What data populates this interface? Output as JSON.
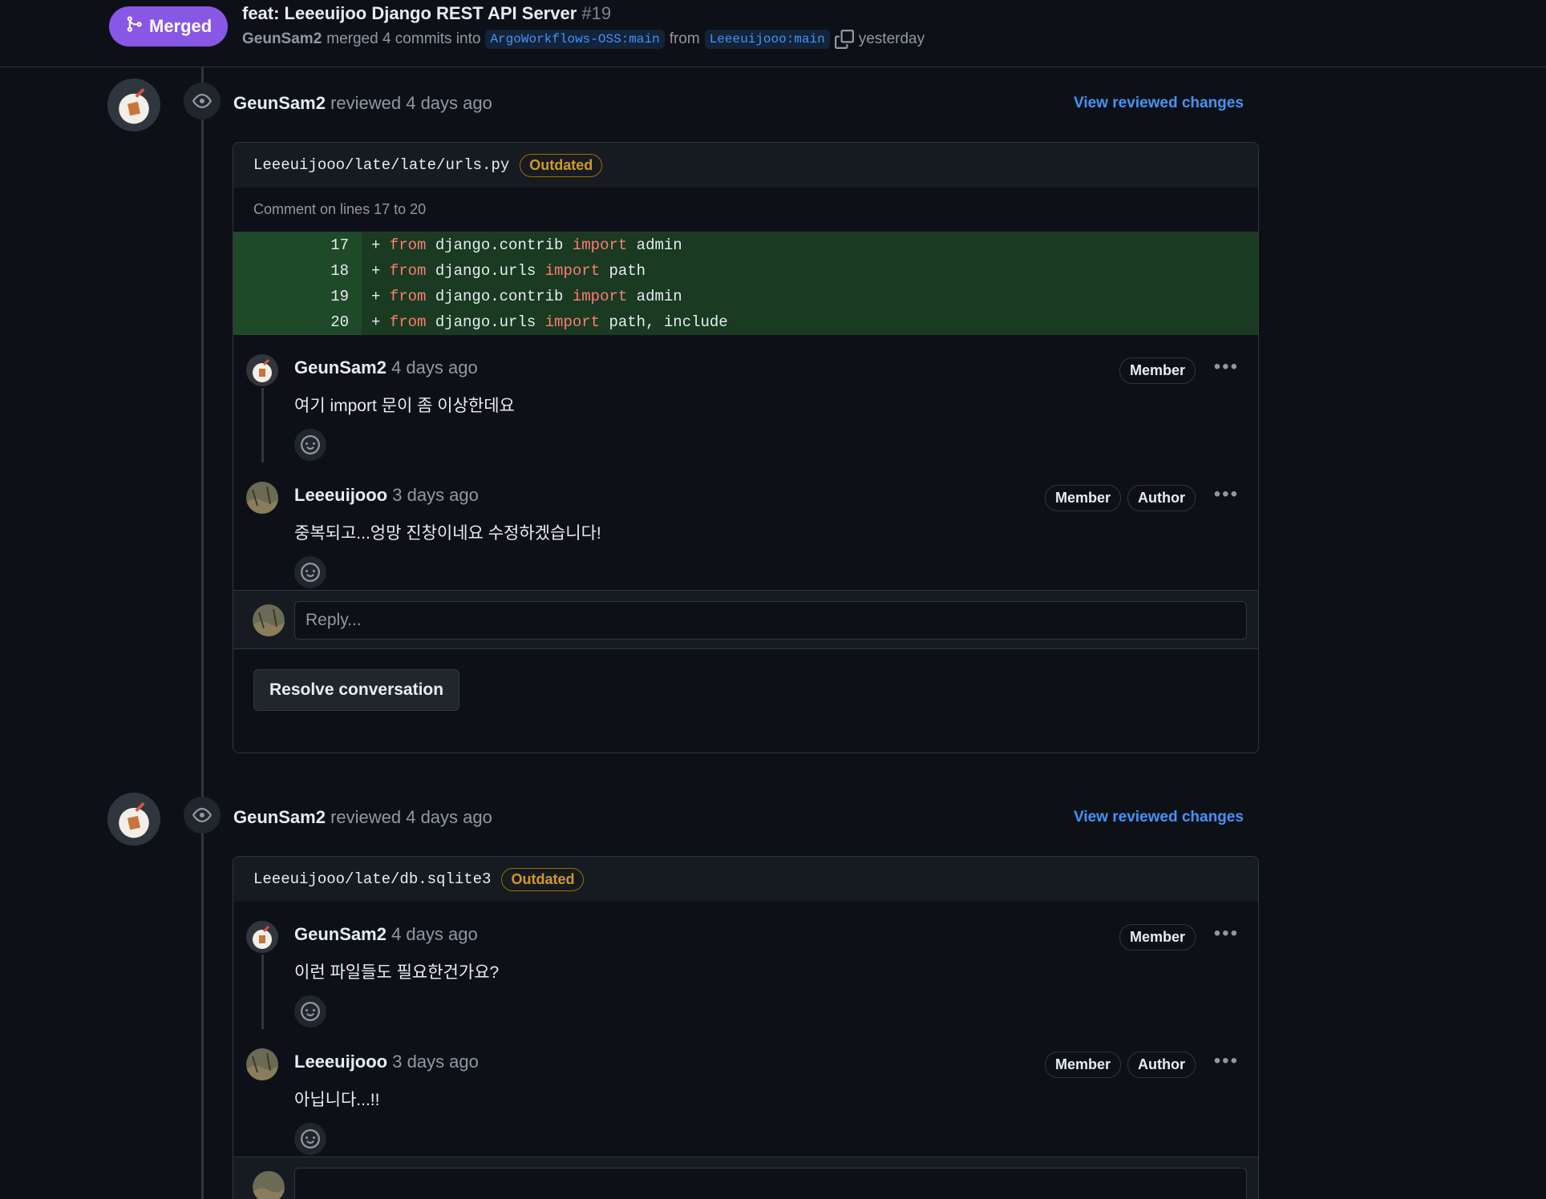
{
  "header": {
    "status": "Merged",
    "title": "feat: Leeeuijoo Django REST API Server",
    "number": "#19",
    "merged_by": "GeunSam2",
    "merged_text": "merged 4 commits into",
    "base_branch": "ArgoWorkflows-OSS:main",
    "from_text": "from",
    "head_branch": "Leeeuijooo:main",
    "time": "yesterday"
  },
  "reviews": [
    {
      "reviewer": "GeunSam2",
      "action": "reviewed 4 days ago",
      "view_link": "View reviewed changes",
      "file_path": "Leeeuijooo/late/late/urls.py",
      "outdated": "Outdated",
      "comment_lines": "Comment on lines 17 to 20",
      "code": [
        {
          "ln": "17",
          "pre": "+ ",
          "kw1": "from",
          "mid": " django.contrib ",
          "kw2": "import",
          "post": " admin"
        },
        {
          "ln": "18",
          "pre": "+ ",
          "kw1": "from",
          "mid": " django.urls ",
          "kw2": "import",
          "post": " path"
        },
        {
          "ln": "19",
          "pre": "+ ",
          "kw1": "from",
          "mid": " django.contrib ",
          "kw2": "import",
          "post": " admin"
        },
        {
          "ln": "20",
          "pre": "+ ",
          "kw1": "from",
          "mid": " django.urls ",
          "kw2": "import",
          "post": " path, include"
        }
      ],
      "comments": [
        {
          "author": "GeunSam2",
          "time": "4 days ago",
          "body": "여기 import 문이 좀 이상한데요",
          "badges": [
            "Member"
          ]
        },
        {
          "author": "Leeeuijooo",
          "time": "3 days ago",
          "body": "중복되고...엉망 진창이네요 수정하겠습니다!",
          "badges": [
            "Member",
            "Author"
          ]
        }
      ],
      "reply_placeholder": "Reply...",
      "resolve_label": "Resolve conversation"
    },
    {
      "reviewer": "GeunSam2",
      "action": "reviewed 4 days ago",
      "view_link": "View reviewed changes",
      "file_path": "Leeeuijooo/late/db.sqlite3",
      "outdated": "Outdated",
      "comments": [
        {
          "author": "GeunSam2",
          "time": "4 days ago",
          "body": "이런 파일들도 필요한건가요?",
          "badges": [
            "Member"
          ]
        },
        {
          "author": "Leeeuijooo",
          "time": "3 days ago",
          "body": "아닙니다...!!",
          "badges": [
            "Member",
            "Author"
          ]
        }
      ]
    }
  ],
  "colors": {
    "merged": "#8957e5",
    "link": "#4493f8",
    "outdated": "#d29922",
    "added_line_bg": "#1a3a22",
    "keyword": "#ff7b72"
  },
  "icons": [
    "git-merge-icon",
    "copy-icon",
    "eye-icon",
    "smiley-icon",
    "kebab-icon"
  ]
}
